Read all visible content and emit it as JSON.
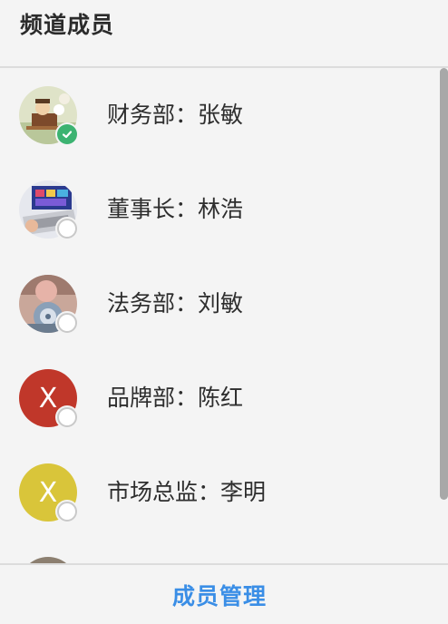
{
  "header": {
    "title": "频道成员"
  },
  "members": [
    {
      "name": "财务部：张敏",
      "avatar_icon": "cartoon-photo-avatar",
      "status": "online"
    },
    {
      "name": "董事长：林浩",
      "avatar_icon": "laptop-photo-avatar",
      "status": "offline"
    },
    {
      "name": "法务部：刘敏",
      "avatar_icon": "flower-photo-avatar",
      "status": "offline"
    },
    {
      "name": "品牌部：陈红",
      "avatar_letter": "X",
      "avatar_color": "#c0372a",
      "status": "offline"
    },
    {
      "name": "市场总监：李明",
      "avatar_letter": "X",
      "avatar_color": "#d9c53a",
      "status": "offline"
    }
  ],
  "footer": {
    "manage_label": "成员管理"
  },
  "colors": {
    "accent": "#3a8ee6",
    "online": "#3cb371"
  }
}
